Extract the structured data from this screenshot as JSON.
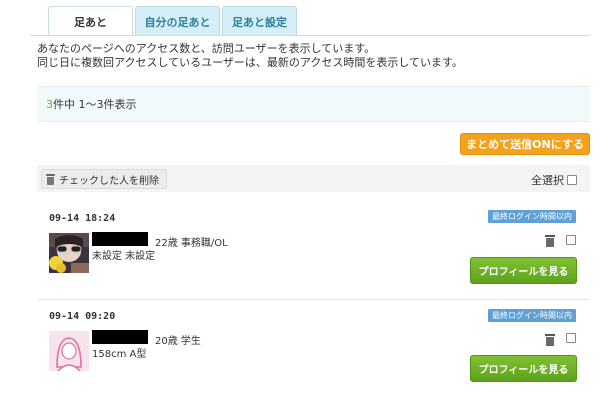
{
  "tabs": {
    "footprints": "足あと",
    "my_footprints": "自分の足あと",
    "settings": "足あと設定"
  },
  "intro": {
    "line1": "あなたのページへのアクセス数と、訪問ユーザーを表示しています。",
    "line2": "同じ日に複数回アクセスしているユーザーは、最新のアクセス時間を表示しています。"
  },
  "count": {
    "total": "3",
    "text": "件中 1〜3件表示"
  },
  "bulk_send_button": "まとめて送信ONにする",
  "actions": {
    "delete_checked": "チェックした人を削除",
    "select_all": "全選択"
  },
  "entries": [
    {
      "time": "09-14 18:24",
      "badge": "最終ログイン時間以内",
      "age_job": "22歳 事務職/OL",
      "detail": "未設定 未設定",
      "profile_button": "プロフィールを見る"
    },
    {
      "time": "09-14 09:20",
      "badge": "最終ログイン時間以内",
      "age_job": "20歳 学生",
      "detail": "158cm A型",
      "profile_button": "プロフィールを見る"
    }
  ],
  "colors": {
    "tab_bg": "#d6eff7",
    "accent_orange": "#f4a11c",
    "green_button": "#6cb128",
    "badge_blue": "#5fa1d6",
    "count_green": "#6fa83b"
  }
}
